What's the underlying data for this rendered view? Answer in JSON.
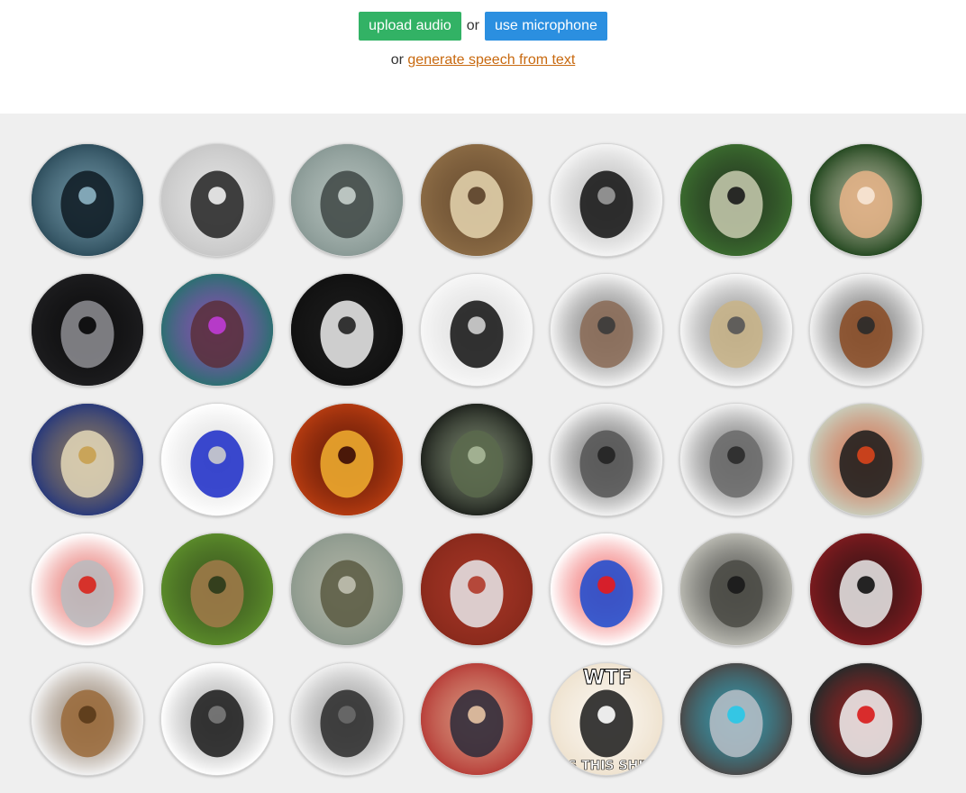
{
  "header": {
    "upload_label": "upload audio",
    "or_label": "or",
    "mic_label": "use microphone",
    "or_prefix": "or",
    "generate_label": "generate speech from text"
  },
  "colors": {
    "upload_button": "#32b265",
    "mic_button": "#2b8fe0",
    "link": "#c8690f",
    "gallery_bg": "#efefef"
  },
  "gallery": {
    "items": [
      {
        "name": "monster-mouth",
        "bg": "#2f4f5e",
        "fg": "#0e1a22",
        "accent": "#8db4c4"
      },
      {
        "name": "gramophone-horn",
        "bg": "#c8c8c8",
        "fg": "#222222",
        "accent": "#f0f0f0"
      },
      {
        "name": "ghost-hand",
        "bg": "#8a9a96",
        "fg": "#3e4644",
        "accent": "#c6d0cc"
      },
      {
        "name": "cathedral",
        "bg": "#8a6a44",
        "fg": "#e6d6b0",
        "accent": "#5a4028"
      },
      {
        "name": "rotary-telephone",
        "bg": "#f4f4f4",
        "fg": "#111111",
        "accent": "#9a9a9a"
      },
      {
        "name": "alien",
        "bg": "#3a6a2e",
        "fg": "#c9cdb0",
        "accent": "#1a1a1a"
      },
      {
        "name": "melting-clock",
        "bg": "#264a22",
        "fg": "#e8b488",
        "accent": "#f7e7d6"
      },
      {
        "name": "grey-alien",
        "bg": "#1c1c1e",
        "fg": "#8f8f94",
        "accent": "#050505"
      },
      {
        "name": "robot-skull",
        "bg": "#2d6f72",
        "fg": "#5a2f3a",
        "accent": "#c03bd6"
      },
      {
        "name": "guy-fawkes-mask",
        "bg": "#111111",
        "fg": "#eeeeee",
        "accent": "#222222"
      },
      {
        "name": "wall-clock",
        "bg": "#f7f7f7",
        "fg": "#111111",
        "accent": "#d0d0d0"
      },
      {
        "name": "radio",
        "bg": "#f4f4f4",
        "fg": "#8a6a55",
        "accent": "#3a3a3a"
      },
      {
        "name": "cymbal",
        "bg": "#f6f6f6",
        "fg": "#c9b487",
        "accent": "#555555"
      },
      {
        "name": "dalek",
        "bg": "#f2f2f2",
        "fg": "#8a4a22",
        "accent": "#2a2a2a"
      },
      {
        "name": "effects-pedal",
        "bg": "#2a3a7a",
        "fg": "#e4d8b8",
        "accent": "#c8a050"
      },
      {
        "name": "sine-wave",
        "bg": "#ffffff",
        "fg": "#1a2ac8",
        "accent": "#cccccc"
      },
      {
        "name": "fire-demon",
        "bg": "#b33a10",
        "fg": "#f2b030",
        "accent": "#3a0a05"
      },
      {
        "name": "cave",
        "bg": "#20241e",
        "fg": "#5a6a4c",
        "accent": "#a8b898"
      },
      {
        "name": "one-eyed-robot",
        "bg": "#f2f2f2",
        "fg": "#555555",
        "accent": "#222222"
      },
      {
        "name": "tall-robot",
        "bg": "#f0f0f0",
        "fg": "#6a6a6a",
        "accent": "#2a2a2a"
      },
      {
        "name": "toy-robot",
        "bg": "#c9cab8",
        "fg": "#1a1a1a",
        "accent": "#d8441c"
      },
      {
        "name": "lego-robot",
        "bg": "#ffffff",
        "fg": "#b8bcc0",
        "accent": "#d8241c"
      },
      {
        "name": "snail",
        "bg": "#5a8a2a",
        "fg": "#a27a4a",
        "accent": "#2a3a1a"
      },
      {
        "name": "tortoise",
        "bg": "#8e9a8e",
        "fg": "#5a5a42",
        "accent": "#c0c0b0"
      },
      {
        "name": "sprinter",
        "bg": "#8a2a1c",
        "fg": "#e8e8ea",
        "accent": "#b03a2a"
      },
      {
        "name": "sonic",
        "bg": "#ffffff",
        "fg": "#1a4ad0",
        "accent": "#e81a1a"
      },
      {
        "name": "soldier-radio",
        "bg": "#b8b8b0",
        "fg": "#4a4a44",
        "accent": "#1a1a1a"
      },
      {
        "name": "playing-cards",
        "bg": "#7a1a1e",
        "fg": "#eaeaea",
        "accent": "#111111"
      },
      {
        "name": "wooden-speaker",
        "bg": "#f2f2f2",
        "fg": "#9a6a3a",
        "accent": "#5a3a1a"
      },
      {
        "name": "phonograph-man",
        "bg": "#ffffff",
        "fg": "#1a1a1a",
        "accent": "#7a7a7a"
      },
      {
        "name": "dark-knight",
        "bg": "#f0f0f0",
        "fg": "#2a2a2a",
        "accent": "#6a6a6a"
      },
      {
        "name": "officer-hat",
        "bg": "#b8403a",
        "fg": "#2a2a3a",
        "accent": "#e8c4a4"
      },
      {
        "name": "wtf-meme",
        "bg": "#efe3d0",
        "fg": "#1a1a1a",
        "accent": "#ffffff",
        "caption_top": "WTF",
        "caption_bottom": "IS THIS SHIT"
      },
      {
        "name": "cute-robot",
        "bg": "#4a4a4a",
        "fg": "#b8c0c8",
        "accent": "#28c8e8"
      },
      {
        "name": "kirobo-robot",
        "bg": "#2a2a2a",
        "fg": "#f2f2f2",
        "accent": "#d81a1a"
      }
    ]
  }
}
